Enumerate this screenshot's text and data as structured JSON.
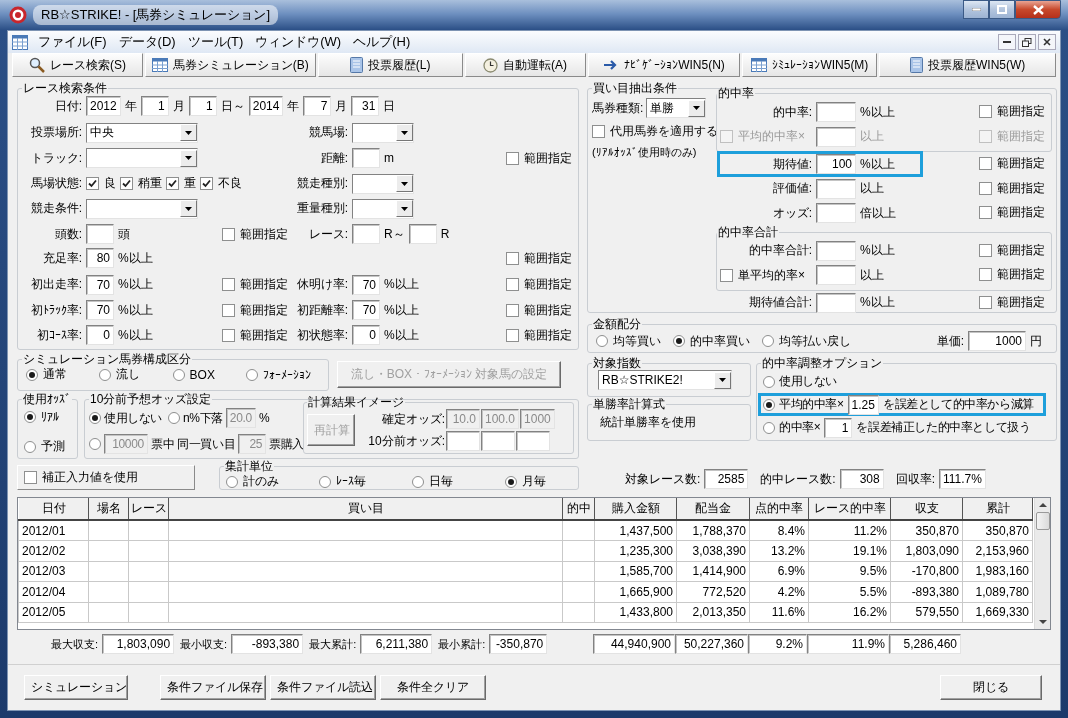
{
  "window": {
    "title": "RB☆STRIKE! - [馬券シミュレーション]"
  },
  "menu": [
    "ファイル(F)",
    "データ(D)",
    "ツール(T)",
    "ウィンドウ(W)",
    "ヘルプ(H)"
  ],
  "toolbar": [
    {
      "label": "レース検索(S)"
    },
    {
      "label": "馬券シミュレーション(B)"
    },
    {
      "label": "投票履歴(L)"
    },
    {
      "label": "自動運転(A)"
    },
    {
      "label": "ﾅﾋﾞｹﾞｰｼｮﾝWIN5(N)"
    },
    {
      "label": "ｼﾐｭﾚｰｼｮﾝWIN5(M)"
    },
    {
      "label": "投票履歴WIN5(W)"
    }
  ],
  "race_search": {
    "title": "レース検索条件",
    "rows": [
      {
        "left": [
          {
            "kind": "label",
            "text": "日付:"
          },
          {
            "kind": "field",
            "value": "2012"
          },
          {
            "kind": "unit",
            "text": "年"
          },
          {
            "kind": "field",
            "value": "1"
          },
          {
            "kind": "unit",
            "text": "月"
          },
          {
            "kind": "field",
            "value": "1"
          },
          {
            "kind": "unit",
            "text": "日～"
          },
          {
            "kind": "field",
            "value": "2014"
          },
          {
            "kind": "unit",
            "text": "年"
          },
          {
            "kind": "field",
            "value": "7"
          },
          {
            "kind": "unit",
            "text": "月"
          },
          {
            "kind": "field",
            "value": "31"
          },
          {
            "kind": "unit",
            "text": "日"
          }
        ]
      },
      {
        "left": [
          {
            "kind": "label",
            "text": "投票場所:"
          },
          {
            "kind": "combo",
            "value": "中央"
          }
        ],
        "mid": [
          {
            "kind": "label",
            "text": "競馬場:"
          },
          {
            "kind": "combo"
          }
        ]
      },
      {
        "left": [
          {
            "kind": "label",
            "text": "トラック:"
          },
          {
            "kind": "combo"
          }
        ],
        "mid": [
          {
            "kind": "label",
            "text": "距離:"
          },
          {
            "kind": "field"
          },
          {
            "kind": "unit",
            "text": "m"
          }
        ],
        "right": [
          {
            "kind": "check",
            "label": "範囲指定",
            "checked": false
          }
        ]
      },
      {
        "left": [
          {
            "kind": "label",
            "text": "馬場状態:"
          },
          {
            "kind": "check",
            "label": "良",
            "checked": true
          },
          {
            "kind": "check",
            "label": "稍重",
            "checked": true
          },
          {
            "kind": "check",
            "label": "重",
            "checked": true
          },
          {
            "kind": "check",
            "label": "不良",
            "checked": true
          }
        ],
        "mid": [
          {
            "kind": "label",
            "text": "競走種別:"
          },
          {
            "kind": "combo"
          }
        ]
      },
      {
        "left": [
          {
            "kind": "label",
            "text": "競走条件:"
          },
          {
            "kind": "combo"
          }
        ],
        "mid": [
          {
            "kind": "label",
            "text": "重量種別:"
          },
          {
            "kind": "combo"
          }
        ]
      },
      {
        "left": [
          {
            "kind": "label",
            "text": "頭数:"
          },
          {
            "kind": "field"
          },
          {
            "kind": "unit",
            "text": "頭"
          },
          {
            "kind": "check",
            "label": "範囲指定",
            "checked": false
          }
        ],
        "mid": [
          {
            "kind": "label",
            "text": "レース:"
          },
          {
            "kind": "field"
          },
          {
            "kind": "unit",
            "text": "R～"
          },
          {
            "kind": "field"
          },
          {
            "kind": "unit",
            "text": "R"
          }
        ]
      },
      {
        "left": [
          {
            "kind": "label",
            "text": "充足率:"
          },
          {
            "kind": "field",
            "value": "80"
          },
          {
            "kind": "unit",
            "text": "%以上"
          },
          {
            "kind": "check",
            "label": "範囲指定",
            "checked": false
          }
        ]
      },
      {
        "left": [
          {
            "kind": "label",
            "text": "初出走率:"
          },
          {
            "kind": "field",
            "value": "70"
          },
          {
            "kind": "unit",
            "text": "%以上"
          },
          {
            "kind": "check",
            "label": "範囲指定",
            "checked": false
          }
        ],
        "mid": [
          {
            "kind": "label",
            "text": "休明け率:"
          },
          {
            "kind": "field",
            "value": "70"
          },
          {
            "kind": "unit",
            "text": "%以上"
          }
        ],
        "right": [
          {
            "kind": "check",
            "label": "範囲指定",
            "checked": false
          }
        ]
      },
      {
        "left": [
          {
            "kind": "label",
            "text": "初ﾄﾗｯｸ率:"
          },
          {
            "kind": "field",
            "value": "70"
          },
          {
            "kind": "unit",
            "text": "%以上"
          },
          {
            "kind": "check",
            "label": "範囲指定",
            "checked": false
          }
        ],
        "mid": [
          {
            "kind": "label",
            "text": "初距離率:"
          },
          {
            "kind": "field",
            "value": "70"
          },
          {
            "kind": "unit",
            "text": "%以上"
          }
        ],
        "right": [
          {
            "kind": "check",
            "label": "範囲指定",
            "checked": false
          }
        ]
      },
      {
        "left": [
          {
            "kind": "label",
            "text": "初ｺｰｽ率:"
          },
          {
            "kind": "field",
            "value": "0"
          },
          {
            "kind": "unit",
            "text": "%以上"
          },
          {
            "kind": "check",
            "label": "範囲指定",
            "checked": false
          }
        ],
        "mid": [
          {
            "kind": "label",
            "text": "初状態率:"
          },
          {
            "kind": "field",
            "value": "0"
          },
          {
            "kind": "unit",
            "text": "%以上"
          }
        ],
        "right": [
          {
            "kind": "check",
            "label": "範囲指定",
            "checked": false
          }
        ]
      }
    ]
  },
  "simulation_type": {
    "title": "シミュレーション馬券構成区分",
    "options": [
      {
        "label": "通常",
        "selected": true
      },
      {
        "label": "流し",
        "selected": false
      },
      {
        "label": "BOX",
        "selected": false
      },
      {
        "label": "ﾌｫｰﾒｰｼｮﾝ",
        "selected": false
      }
    ],
    "button": {
      "label": "流し・BOX・ﾌｫｰﾒｰｼｮﾝ 対象馬の設定",
      "disabled": true
    }
  },
  "odds_used": {
    "title": "使用ｵｯｽﾞ",
    "options": [
      {
        "label": "ﾘｱﾙ",
        "selected": true
      },
      {
        "label": "予測",
        "selected": false
      }
    ]
  },
  "ten_min_odds": {
    "title": "10分前予想オッズ設定",
    "options": [
      {
        "selected": true,
        "parts": [
          {
            "kind": "text",
            "text": "使用しない"
          }
        ]
      },
      {
        "selected": false,
        "parts": [
          {
            "kind": "text",
            "text": "n%下落"
          },
          {
            "kind": "field",
            "value": "20.0",
            "disabled": true
          },
          {
            "kind": "text",
            "text": "%"
          }
        ]
      },
      {
        "selected": false,
        "parts": [
          {
            "kind": "field",
            "value": "10000",
            "disabled": true
          },
          {
            "kind": "text",
            "text": "票中 同一買い目"
          },
          {
            "kind": "field",
            "value": "25",
            "disabled": true
          },
          {
            "kind": "text",
            "text": "票購入"
          }
        ]
      }
    ],
    "calc_image": {
      "title": "計算結果イメージ",
      "button": {
        "label": "再計算",
        "disabled": true
      },
      "rows": [
        {
          "label": "確定オッズ:",
          "fields": [
            {
              "value": "10.0",
              "disabled": true
            },
            {
              "value": "100.0",
              "disabled": true
            },
            {
              "value": "1000",
              "disabled": true
            }
          ]
        },
        {
          "label": "10分前オッズ:",
          "fields": [
            {
              "disabled": false
            },
            {
              "disabled": false
            },
            {
              "disabled": false
            }
          ]
        }
      ]
    }
  },
  "correction": {
    "label": "補正入力値を使用",
    "checked": false
  },
  "aggregate": {
    "title": "集計単位",
    "options": [
      {
        "label": "計のみ",
        "selected": false
      },
      {
        "label": "ﾚｰｽ毎",
        "selected": false
      },
      {
        "label": "日毎",
        "selected": false
      },
      {
        "label": "月毎",
        "selected": true
      }
    ]
  },
  "buy_conditions": {
    "title": "買い目抽出条件",
    "ticket_type": {
      "label": "馬券種類:",
      "value": "単勝"
    },
    "substitute": {
      "label": "代用馬券を適用する",
      "checked": false
    },
    "note": "(ﾘｱﾙｵｯｽﾞ使用時のみ)",
    "groups": [
      {
        "title": "的中率",
        "rows": [
          {
            "kind": "label",
            "label": "的中率:",
            "unit": "%以上",
            "range": {
              "label": "範囲指定",
              "checked": false
            },
            "disabled": false,
            "highlighted": false
          },
          {
            "kind": "check",
            "label": "平均的中率×",
            "checked": false,
            "unit": "以上",
            "range": {
              "label": "範囲指定",
              "checked": false
            },
            "disabled": true,
            "highlighted": false
          }
        ]
      },
      {
        "rows": [
          {
            "kind": "label",
            "label": "期待値:",
            "value": "100",
            "unit": "%以上",
            "range": {
              "label": "範囲指定",
              "checked": false
            },
            "disabled": false,
            "highlighted": true
          },
          {
            "kind": "label",
            "label": "評価値:",
            "unit": "以上",
            "range": {
              "label": "範囲指定",
              "checked": false
            },
            "disabled": false,
            "highlighted": false
          },
          {
            "kind": "label",
            "label": "オッズ:",
            "unit": "倍以上",
            "range": {
              "label": "範囲指定",
              "checked": false
            },
            "disabled": false,
            "highlighted": false
          }
        ]
      },
      {
        "title": "的中率合計",
        "rows": [
          {
            "kind": "label",
            "label": "的中率合計:",
            "unit": "%以上",
            "range": {
              "label": "範囲指定",
              "checked": false
            },
            "disabled": false,
            "highlighted": false
          },
          {
            "kind": "check",
            "label": "単平均的率×",
            "checked": false,
            "unit": "以上",
            "range": {
              "label": "範囲指定",
              "checked": false
            },
            "disabled": false,
            "highlighted": false
          }
        ]
      },
      {
        "rows": [
          {
            "kind": "label",
            "label": "期待値合計:",
            "unit": "%以上",
            "range": {
              "label": "範囲指定",
              "checked": false
            },
            "disabled": false,
            "highlighted": false
          }
        ]
      }
    ]
  },
  "money_allocation": {
    "title": "金額配分",
    "options": [
      {
        "label": "均等買い",
        "selected": false
      },
      {
        "label": "的中率買い",
        "selected": true
      },
      {
        "label": "均等払い戻し",
        "selected": false
      }
    ],
    "unit_price": {
      "label": "単価:",
      "value": "1000",
      "unit": "円"
    }
  },
  "target_index": {
    "title": "対象指数",
    "value": "RB☆STRIKE2!"
  },
  "win_rate_formula": {
    "title": "単勝率計算式",
    "text": "統計単勝率を使用"
  },
  "hit_adjust": {
    "title": "的中率調整オプション",
    "options": [
      {
        "selected": false,
        "highlighted": false,
        "parts": [
          {
            "kind": "text",
            "text": "使用しない"
          }
        ]
      },
      {
        "selected": true,
        "highlighted": true,
        "parts": [
          {
            "kind": "text",
            "text": "平均的中率×"
          },
          {
            "kind": "field",
            "value": "1.25"
          },
          {
            "kind": "text",
            "text": "を誤差として的中率から減算"
          }
        ]
      },
      {
        "selected": false,
        "highlighted": false,
        "parts": [
          {
            "kind": "text",
            "text": "的中率×"
          },
          {
            "kind": "field",
            "value": "1"
          },
          {
            "kind": "text",
            "text": "を誤差補正した的中率として扱う"
          }
        ]
      }
    ]
  },
  "counts": [
    {
      "label": "対象レース数:",
      "value": "2585"
    },
    {
      "label": "的中レース数:",
      "value": "308"
    },
    {
      "label": "回収率:",
      "value": "111.7%"
    }
  ],
  "table": {
    "columns": [
      "日付",
      "場名",
      "レース",
      "買い目",
      "的中",
      "購入金額",
      "配当金",
      "点的中率",
      "レース的中率",
      "収支",
      "累計"
    ],
    "rows": [
      [
        "2012/01",
        null,
        null,
        null,
        null,
        "1,437,500",
        "1,788,370",
        "8.4%",
        "11.2%",
        "350,870",
        "350,870"
      ],
      [
        "2012/02",
        null,
        null,
        null,
        null,
        "1,235,300",
        "3,038,390",
        "13.2%",
        "19.1%",
        "1,803,090",
        "2,153,960"
      ],
      [
        "2012/03",
        null,
        null,
        null,
        null,
        "1,585,700",
        "1,414,900",
        "6.9%",
        "9.5%",
        "-170,800",
        "1,983,160"
      ],
      [
        "2012/04",
        null,
        null,
        null,
        null,
        "1,665,900",
        "772,520",
        "4.2%",
        "5.5%",
        "-893,380",
        "1,089,780"
      ],
      [
        "2012/05",
        null,
        null,
        null,
        null,
        "1,433,800",
        "2,013,350",
        "11.6%",
        "16.2%",
        "579,550",
        "1,669,330"
      ]
    ]
  },
  "summary": {
    "stats": [
      {
        "label": "最大収支:",
        "value": "1,803,090"
      },
      {
        "label": "最小収支:",
        "value": "-893,380"
      },
      {
        "label": "最大累計:",
        "value": "6,211,380"
      },
      {
        "label": "最小累計:",
        "value": "-350,870"
      }
    ],
    "totals": [
      "44,940,900",
      "50,227,360",
      "9.2%",
      "11.9%",
      "5,286,460"
    ]
  },
  "buttons": [
    {
      "label": "シミュレーション"
    },
    {
      "label": "条件ファイル保存"
    },
    {
      "label": "条件ファイル読込"
    },
    {
      "label": "条件全クリア"
    }
  ],
  "close_button": {
    "label": "閉じる"
  }
}
